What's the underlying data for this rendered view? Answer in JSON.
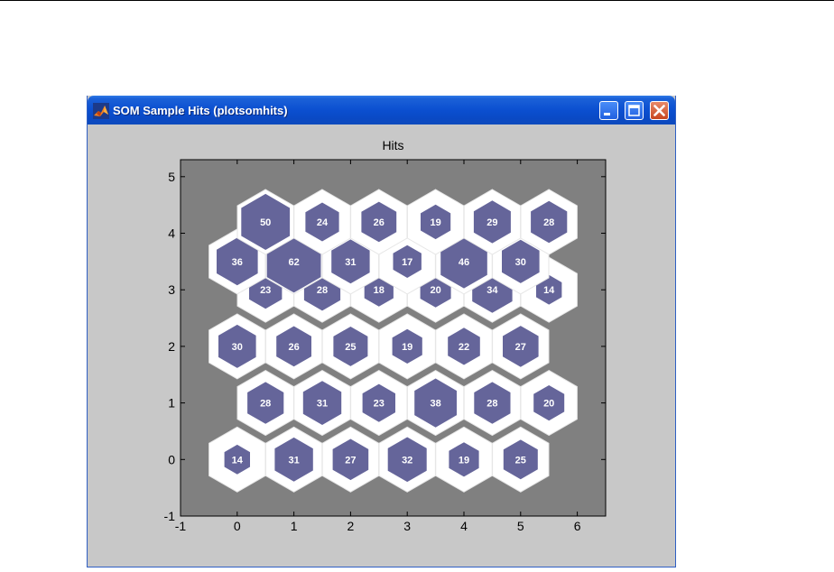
{
  "window": {
    "title": "SOM Sample Hits (plotsomhits)",
    "icon": "matlab-icon",
    "controls": [
      "minimize-icon",
      "maximize-icon",
      "close-icon"
    ]
  },
  "colors": {
    "plot_background": "#808080",
    "figure_background": "#c8c8c8",
    "neuron_outline": "#ffffff",
    "hit_fill": "#65659a",
    "label": "#ffffff"
  },
  "chart_data": {
    "type": "hexagonal-hits",
    "title": "Hits",
    "xlim": [
      -1,
      6.5
    ],
    "ylim": [
      -1,
      5.3
    ],
    "xticks": [
      -1,
      0,
      1,
      2,
      3,
      4,
      5,
      6
    ],
    "yticks": [
      -1,
      0,
      1,
      2,
      3,
      4,
      5
    ],
    "max_hits": 62,
    "cells": [
      {
        "x": 0,
        "y": 0,
        "hits": 14
      },
      {
        "x": 1,
        "y": 0,
        "hits": 31
      },
      {
        "x": 2,
        "y": 0,
        "hits": 27
      },
      {
        "x": 3,
        "y": 0,
        "hits": 32
      },
      {
        "x": 4,
        "y": 0,
        "hits": 19
      },
      {
        "x": 5,
        "y": 0,
        "hits": 25
      },
      {
        "x": 0.5,
        "y": 1,
        "hits": 28
      },
      {
        "x": 1.5,
        "y": 1,
        "hits": 31
      },
      {
        "x": 2.5,
        "y": 1,
        "hits": 23
      },
      {
        "x": 3.5,
        "y": 1,
        "hits": 38
      },
      {
        "x": 4.5,
        "y": 1,
        "hits": 28
      },
      {
        "x": 5.5,
        "y": 1,
        "hits": 20
      },
      {
        "x": 0,
        "y": 2,
        "hits": 30
      },
      {
        "x": 1,
        "y": 2,
        "hits": 26
      },
      {
        "x": 2,
        "y": 2,
        "hits": 25
      },
      {
        "x": 3,
        "y": 2,
        "hits": 19
      },
      {
        "x": 4,
        "y": 2,
        "hits": 22
      },
      {
        "x": 5,
        "y": 2,
        "hits": 27
      },
      {
        "x": 0.5,
        "y": 3,
        "hits": 23
      },
      {
        "x": 1.5,
        "y": 3,
        "hits": 28
      },
      {
        "x": 2.5,
        "y": 3,
        "hits": 18
      },
      {
        "x": 3.5,
        "y": 3,
        "hits": 20
      },
      {
        "x": 4.5,
        "y": 3,
        "hits": 34
      },
      {
        "x": 5.5,
        "y": 3,
        "hits": 14
      },
      {
        "x": 0,
        "y": 3.5,
        "hits": 36
      },
      {
        "x": 1,
        "y": 3.5,
        "hits": 62
      },
      {
        "x": 2,
        "y": 3.5,
        "hits": 31
      },
      {
        "x": 3,
        "y": 3.5,
        "hits": 17
      },
      {
        "x": 4,
        "y": 3.5,
        "hits": 46
      },
      {
        "x": 5,
        "y": 3.5,
        "hits": 30
      },
      {
        "x": 0.5,
        "y": 4.2,
        "hits": 50
      },
      {
        "x": 1.5,
        "y": 4.2,
        "hits": 24
      },
      {
        "x": 2.5,
        "y": 4.2,
        "hits": 26
      },
      {
        "x": 3.5,
        "y": 4.2,
        "hits": 19
      },
      {
        "x": 4.5,
        "y": 4.2,
        "hits": 29
      },
      {
        "x": 5.5,
        "y": 4.2,
        "hits": 28
      }
    ]
  }
}
